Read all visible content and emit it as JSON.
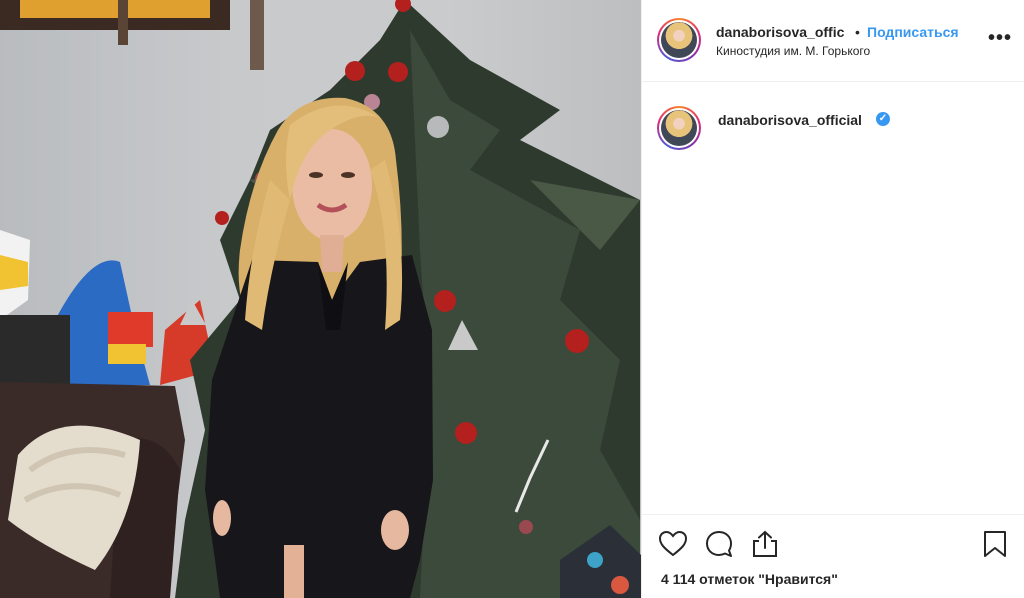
{
  "post": {
    "username": "danaborisova_official",
    "username_truncated": "danaborisova_offic",
    "separator": "•",
    "follow_label": "Подписаться",
    "location": "Киностудия им. М. Горького",
    "more_glyph": "•••"
  },
  "caption": {
    "username": "danaborisova_official",
    "verified_glyph": "✓"
  },
  "actions": {
    "like_icon": "heart-icon",
    "comment_icon": "comment-icon",
    "share_icon": "share-icon",
    "save_icon": "bookmark-icon",
    "likes_text": "4 114 отметок \"Нравится\""
  },
  "colors": {
    "link_blue": "#3897f0",
    "text": "#262626",
    "divider": "#efefef"
  }
}
